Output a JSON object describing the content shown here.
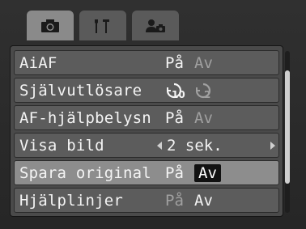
{
  "tabs": [
    {
      "icon": "camera-icon",
      "active": true
    },
    {
      "icon": "tools-icon",
      "active": false
    },
    {
      "icon": "my-menu-icon",
      "active": false
    }
  ],
  "menu": {
    "items": [
      {
        "label": "AiAF",
        "opt_on": "På",
        "opt_off": "Av"
      },
      {
        "label": "Självutlösare",
        "opt_on": "10",
        "opt_off": "2"
      },
      {
        "label": "AF-hjälpbelysn",
        "opt_on": "På",
        "opt_off": "Av"
      },
      {
        "label": "Visa bild",
        "value": "2 sek."
      },
      {
        "label": "Spara original",
        "opt_on": "På",
        "opt_off": "Av"
      },
      {
        "label": "Hjälplinjer",
        "opt_on": "På",
        "opt_off": "Av"
      }
    ],
    "selected_index": 4
  },
  "scroll": {
    "position_fraction": 0.12
  }
}
